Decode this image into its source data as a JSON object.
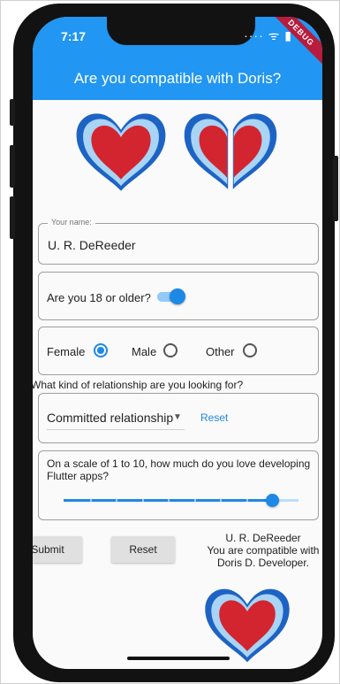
{
  "status_bar": {
    "time": "7:17",
    "icons": "···· ᯤ ▮",
    "debug_badge": "DEBUG"
  },
  "app_bar": {
    "title": "Are you compatible with Doris?",
    "color": "#2196f3"
  },
  "name_field": {
    "label": "Your name:",
    "value": "U. R. DeReeder"
  },
  "age_switch": {
    "label": "Are you 18 or older?",
    "on": true
  },
  "gender": {
    "options": [
      "Female",
      "Male",
      "Other"
    ],
    "selected": "Female"
  },
  "relationship": {
    "question": "What kind of relationship are you looking for?",
    "selected": "Committed relationship",
    "reset_label": "Reset"
  },
  "love_scale": {
    "label": "On a scale of 1 to 10, how much do you love developing Flutter apps?",
    "min": 1,
    "max": 10,
    "value": 9
  },
  "actions": {
    "submit_label": "Submit",
    "reset_label": "Reset"
  },
  "result": {
    "line1": "U. R. DeReeder",
    "line2": "You are compatible with",
    "line3": "Doris D. Developer."
  },
  "accent_color": "#1e88e5",
  "heart_colors": {
    "fill": "#d3252f",
    "rim_outer": "#1565c0",
    "rim_inner": "#90caf9"
  }
}
